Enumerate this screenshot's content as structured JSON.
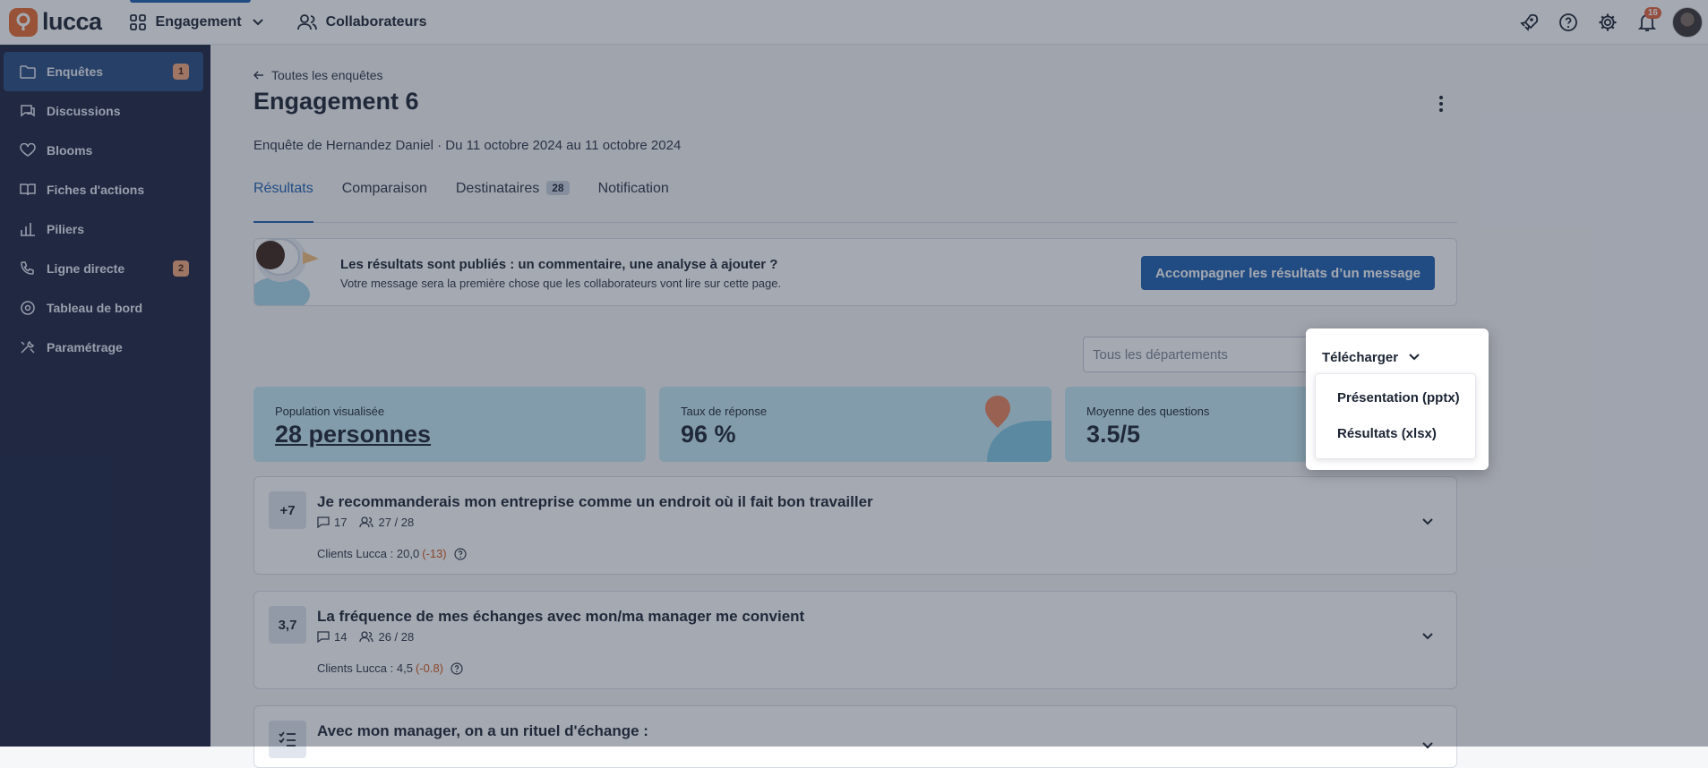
{
  "app": {
    "logo_text": "lucca"
  },
  "topnav": {
    "engagement_label": "Engagement",
    "collaborateurs_label": "Collaborateurs",
    "notification_count": "16"
  },
  "sidebar": {
    "items": [
      {
        "label": "Enquêtes",
        "badge": "1",
        "icon": "folder-icon"
      },
      {
        "label": "Discussions",
        "icon": "chat-icon"
      },
      {
        "label": "Blooms",
        "icon": "heart-icon"
      },
      {
        "label": "Fiches d'actions",
        "icon": "book-icon"
      },
      {
        "label": "Piliers",
        "icon": "bar-chart-icon"
      },
      {
        "label": "Ligne directe",
        "badge": "2",
        "icon": "phone-icon"
      },
      {
        "label": "Tableau de bord",
        "icon": "gauge-icon"
      },
      {
        "label": "Paramétrage",
        "icon": "tools-icon"
      }
    ]
  },
  "page": {
    "back_label": "Toutes les enquêtes",
    "title": "Engagement 6",
    "subtitle": "Enquête de Hernandez Daniel · Du 11 octobre 2024 au 11 octobre 2024"
  },
  "tabs": [
    {
      "label": "Résultats",
      "active": true
    },
    {
      "label": "Comparaison"
    },
    {
      "label": "Destinataires",
      "count": "28"
    },
    {
      "label": "Notification"
    }
  ],
  "banner": {
    "title": "Les résultats sont publiés : un commentaire, une analyse à ajouter ?",
    "text": "Votre message sera la première chose que les collaborateurs vont lire sur cette page.",
    "button_label": "Accompagner les résultats d’un message"
  },
  "filter": {
    "placeholder": "Tous les départements"
  },
  "download": {
    "label": "Télécharger",
    "options": [
      "Présentation (pptx)",
      "Résultats (xlsx)"
    ]
  },
  "stats": [
    {
      "label": "Population visualisée",
      "value": "28 personnes"
    },
    {
      "label": "Taux de réponse",
      "value": "96 %"
    },
    {
      "label": "Moyenne des questions",
      "value": "3.5/5"
    }
  ],
  "questions": [
    {
      "score": "+7",
      "title": "Je recommanderais mon entreprise comme un endroit où il fait bon travailler",
      "comments": "17",
      "respondents": "27 / 28",
      "benchmark": "Clients Lucca : 20,0",
      "delta": "(-13)"
    },
    {
      "score": "3,7",
      "title": "La fréquence de mes échanges avec mon/ma manager me convient",
      "comments": "14",
      "respondents": "26 / 28",
      "benchmark": "Clients Lucca : 4,5",
      "delta": "(-0.8)"
    },
    {
      "title": "Avec mon manager, on a un rituel d'échange :"
    }
  ],
  "colors": {
    "accent": "#1c5fb0",
    "sidebar": "#1a2240",
    "brand": "#e86a2e",
    "delta": "#d0561b"
  }
}
